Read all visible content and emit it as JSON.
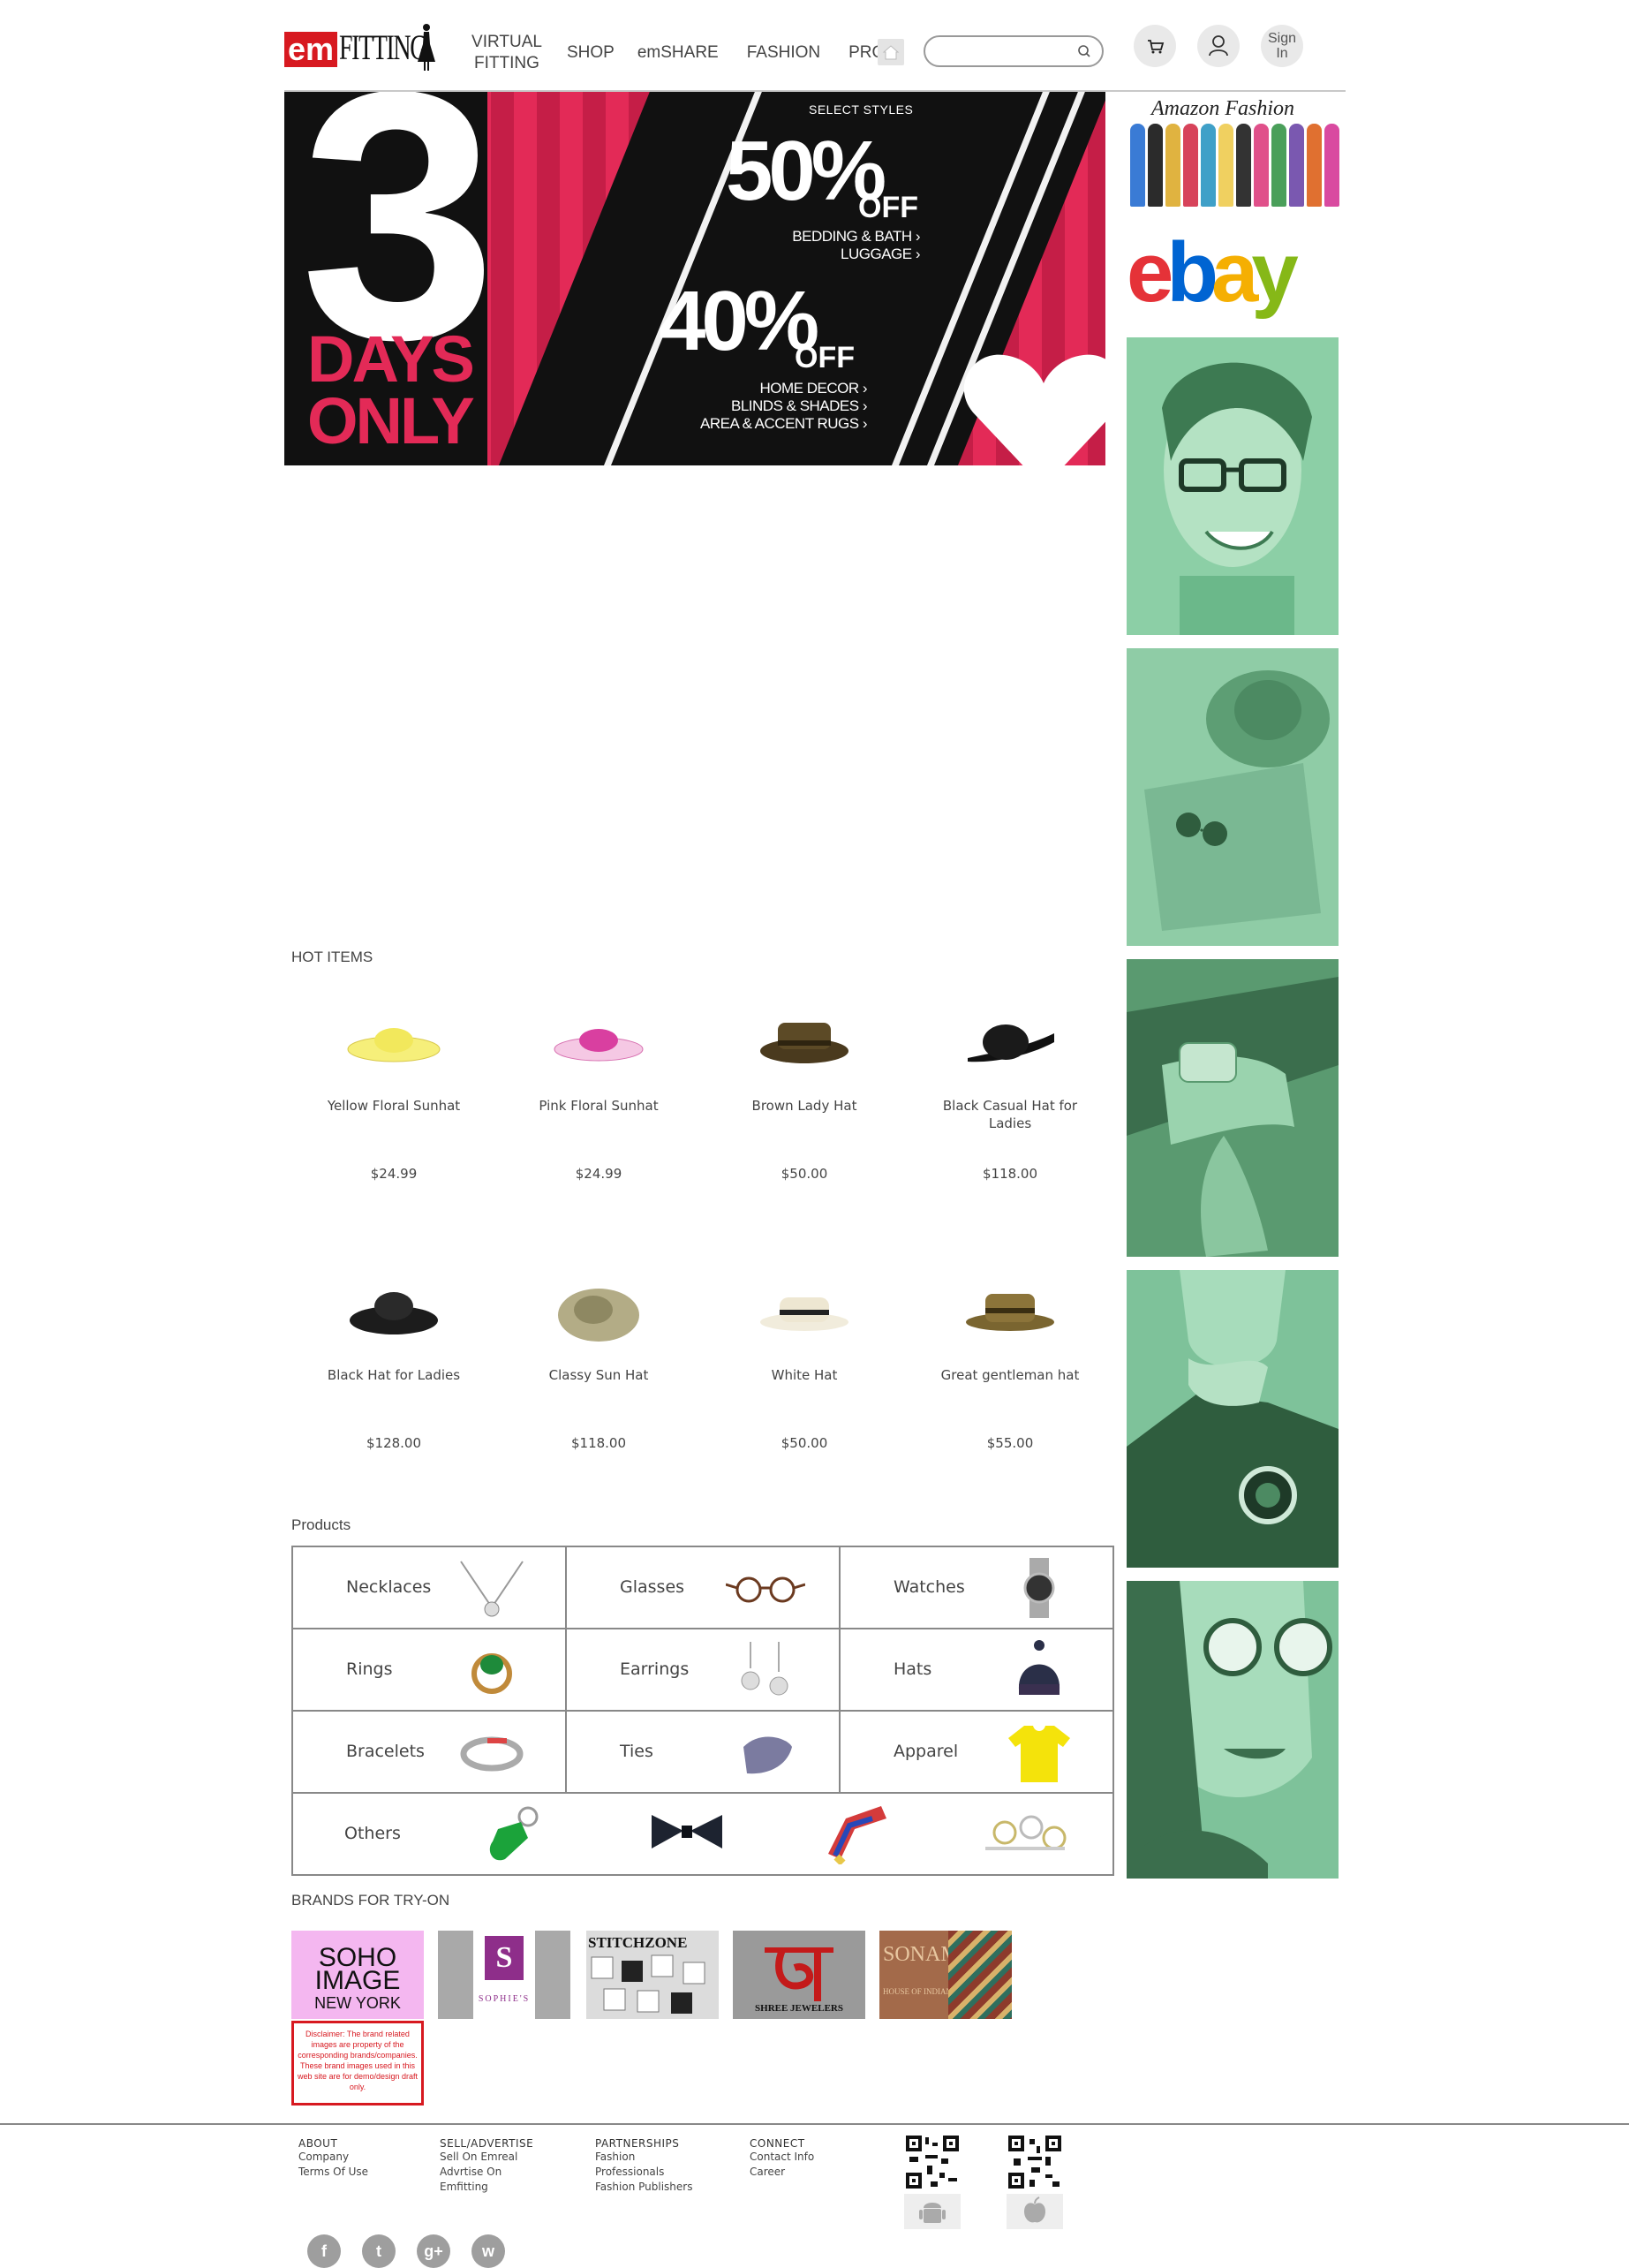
{
  "header": {
    "logo_em": "em",
    "logo_fitting": "FITTING",
    "nav": {
      "virtual_fitting_1": "VIRTUAL",
      "virtual_fitting_2": "FITTING",
      "shop": "SHOP",
      "emshare": "emSHARE",
      "fashion": "FASHION",
      "pros": "PROS"
    },
    "search_placeholder": "",
    "signin_1": "Sign",
    "signin_2": "In"
  },
  "hero": {
    "number": "3",
    "days": "DAYS",
    "only": "ONLY",
    "select_styles": "SELECT STYLES",
    "pct1": "50%",
    "off1": "OFF",
    "desc1_a": "BEDDING & BATH ›",
    "desc1_b": "LUGGAGE ›",
    "pct2": "40%",
    "off2": "OFF",
    "desc2_a": "HOME DECOR ›",
    "desc2_b": "BLINDS & SHADES ›",
    "desc2_c": "AREA & ACCENT RUGS ›"
  },
  "sidebar": {
    "amazon_title": "Amazon Fashion",
    "ebay": [
      "e",
      "b",
      "a",
      "y"
    ],
    "ebay_colors": [
      "#e53238",
      "#0064d2",
      "#f5af02",
      "#86b817"
    ]
  },
  "hot_items": {
    "title": "HOT ITEMS",
    "items": [
      {
        "name": "Yellow Floral Sunhat",
        "price": "$24.99"
      },
      {
        "name": "Pink Floral Sunhat",
        "price": "$24.99"
      },
      {
        "name": "Brown Lady Hat",
        "price": "$50.00"
      },
      {
        "name": "Black Casual Hat for Ladies",
        "price": "$118.00"
      },
      {
        "name": "Black Hat for Ladies",
        "price": "$128.00"
      },
      {
        "name": "Classy Sun Hat",
        "price": "$118.00"
      },
      {
        "name": "White Hat",
        "price": "$50.00"
      },
      {
        "name": "Great gentleman hat",
        "price": "$55.00"
      }
    ]
  },
  "products": {
    "title": "Products",
    "cells": [
      "Necklaces",
      "Glasses",
      "Watches",
      "Rings",
      "Earrings",
      "Hats",
      "Bracelets",
      "Ties",
      "Apparel"
    ],
    "others": "Others"
  },
  "brands": {
    "title": "BRANDS FOR TRY-ON",
    "soho_a": "SOHO IMAGE",
    "soho_b": "NEW YORK",
    "sophie_s": "S",
    "sophie_t": "SOPHIE'S",
    "stitch": "STITCHZONE",
    "shree": "SHREE JEWELERS",
    "sonam": "SONAM",
    "sonam_sub": "HOUSE OF INDIAN FASHION",
    "disclaimer": "Disclaimer: The brand related images are property of the corresponding brands/companies. These brand images used in this web site are for demo/design draft only."
  },
  "footer": {
    "about": {
      "h": "ABOUT",
      "l1": "Company",
      "l2": "Terms Of Use"
    },
    "sell": {
      "h": "SELL/ADVERTISE",
      "l1": "Sell On Emreal",
      "l2": "Advrtise On",
      "l3": "Emfitting"
    },
    "partnerships": {
      "h": "PARTNERSHIPS",
      "l1": "Fashion",
      "l2": "Professionals",
      "l3": "Fashion Publishers"
    },
    "connect": {
      "h": "CONNECT",
      "l1": "Contact Info",
      "l2": "Career"
    },
    "social": [
      "f",
      "t",
      "g+",
      "w"
    ]
  }
}
